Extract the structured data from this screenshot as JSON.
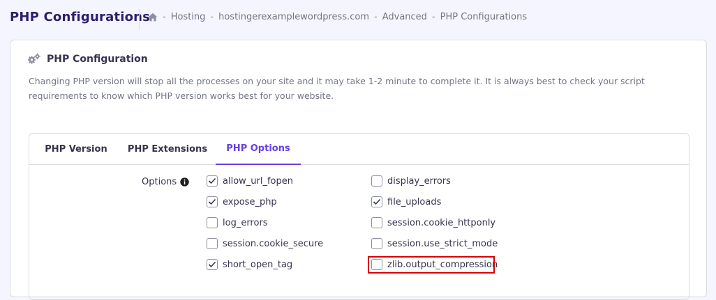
{
  "header": {
    "title": "PHP Configurations",
    "breadcrumb": {
      "home_icon": "home-icon",
      "separator": "-",
      "items": [
        "Hosting",
        "hostingerexamplewordpress.com",
        "Advanced",
        "PHP Configurations"
      ]
    }
  },
  "card": {
    "icon": "gears-icon",
    "title": "PHP Configuration",
    "description": "Changing PHP version will stop all the processes on your site and it may take 1-2 minute to complete it. It is always best to check your script requirements to know which PHP version works best for your website."
  },
  "tabs": [
    {
      "label": "PHP Version",
      "active": false
    },
    {
      "label": "PHP Extensions",
      "active": false
    },
    {
      "label": "PHP Options",
      "active": true
    }
  ],
  "options": {
    "label": "Options",
    "info_icon": "info-icon",
    "items": [
      {
        "name": "allow_url_fopen",
        "checked": true
      },
      {
        "name": "display_errors",
        "checked": false
      },
      {
        "name": "expose_php",
        "checked": true
      },
      {
        "name": "file_uploads",
        "checked": true
      },
      {
        "name": "log_errors",
        "checked": false
      },
      {
        "name": "session.cookie_httponly",
        "checked": false
      },
      {
        "name": "session.cookie_secure",
        "checked": false
      },
      {
        "name": "session.use_strict_mode",
        "checked": false
      },
      {
        "name": "short_open_tag",
        "checked": true
      },
      {
        "name": "zlib.output_compression",
        "checked": false,
        "highlighted": true
      }
    ]
  },
  "colors": {
    "accent": "#673de6",
    "highlight": "#d90000",
    "background": "#f4f5ff"
  }
}
